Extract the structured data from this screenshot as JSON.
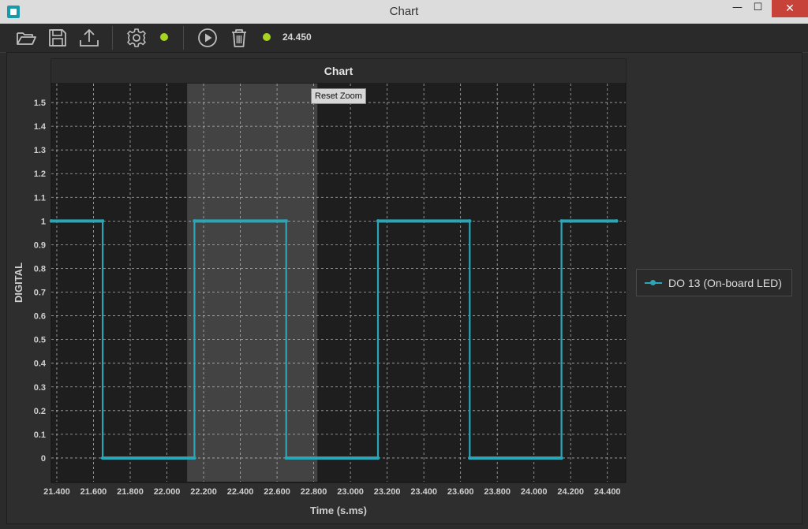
{
  "window": {
    "title": "Chart",
    "minimize": "—",
    "maximize": "☐",
    "close": "✕"
  },
  "toolbar": {
    "items": [
      "folder-open",
      "save",
      "upload",
      "settings",
      "play",
      "trash"
    ],
    "status_color": "#a6d421",
    "value": "24.450"
  },
  "chart": {
    "reset_zoom_label": "Reset Zoom"
  },
  "legend": {
    "label": "DO 13 (On-board LED)"
  },
  "chart_data": {
    "type": "line",
    "title": "Chart",
    "xlabel": "Time (s.ms)",
    "ylabel": "DIGITAL",
    "xlim": [
      21.37,
      24.5
    ],
    "ylim": [
      -0.1,
      1.58
    ],
    "xticks": [
      "21.400",
      "21.600",
      "21.800",
      "22.000",
      "22.200",
      "22.400",
      "22.600",
      "22.800",
      "23.000",
      "23.200",
      "23.400",
      "23.600",
      "23.800",
      "24.000",
      "24.200",
      "24.400"
    ],
    "yticks": [
      "0",
      "0.1",
      "0.2",
      "0.3",
      "0.4",
      "0.5",
      "0.6",
      "0.7",
      "0.8",
      "0.9",
      "1",
      "1.1",
      "1.2",
      "1.3",
      "1.4",
      "1.5"
    ],
    "grid": true,
    "legend": "right",
    "highlight_band": [
      22.11,
      22.82
    ],
    "series": [
      {
        "name": "DO 13 (On-board LED)",
        "color": "#29a7b8",
        "x": [
          21.37,
          21.65,
          21.65,
          22.15,
          22.15,
          22.65,
          22.65,
          23.15,
          23.15,
          23.65,
          23.65,
          24.15,
          24.15,
          24.45
        ],
        "y": [
          1,
          1,
          0,
          0,
          1,
          1,
          0,
          0,
          1,
          1,
          0,
          0,
          1,
          1
        ]
      }
    ]
  }
}
